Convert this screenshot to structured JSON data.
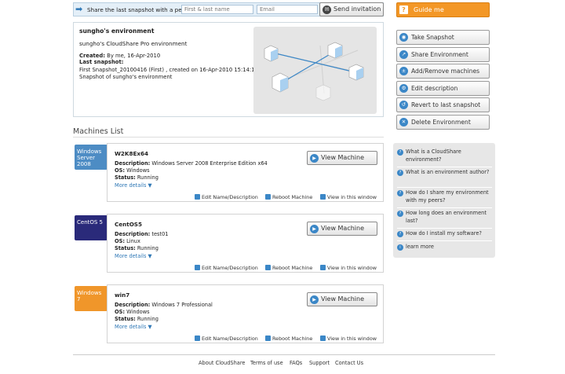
{
  "share": {
    "label": "Share the last snapshot with a peer:",
    "name_placeholder": "First & last name",
    "email_placeholder": "Email",
    "send_label": "Send invitation"
  },
  "guide": {
    "label": "Guide me"
  },
  "environment": {
    "title": "sungho's environment",
    "subtitle": "sungho's CloudShare Pro environment",
    "created_label": "Created:",
    "created_value": "By me, 16-Apr-2010",
    "last_snapshot_label": "Last snapshot:",
    "last_snapshot_value": "First Snapshot_20100416 (First) , created on 16-Apr-2010 15:14:14",
    "last_snapshot_desc": "Snapshot of sungho's environment"
  },
  "machines_list": {
    "title": "Machines List",
    "labels": {
      "description": "Description:",
      "os": "OS:",
      "status": "Status:"
    },
    "more_details": "More details",
    "view_label": "View Machine",
    "actions": {
      "edit": "Edit Name/Description",
      "reboot": "Reboot Machine",
      "view_window": "View in this window"
    },
    "machines": [
      {
        "logo": "Windows Server 2008",
        "logo_color": "#4d8cc4",
        "name": "W2K8Ex64",
        "description": "Windows Server 2008 Enterprise Edition x64",
        "os": "Windows",
        "status": "Running"
      },
      {
        "logo": "CentOS 5",
        "logo_color": "#2a2a7a",
        "name": "CentOS5",
        "description": "test01",
        "os": "Linux",
        "status": "Running"
      },
      {
        "logo": "Windows 7",
        "logo_color": "#f0962a",
        "name": "win7",
        "description": "Windows 7 Professional",
        "os": "Windows",
        "status": "Running"
      }
    ]
  },
  "right_actions": [
    {
      "label": "Take Snapshot",
      "icon": "camera-icon"
    },
    {
      "label": "Share Environment",
      "icon": "share-icon"
    },
    {
      "label": "Add/Remove machines",
      "icon": "add-remove-icon"
    },
    {
      "label": "Edit description",
      "icon": "gear-icon"
    },
    {
      "label": "Revert to last snapshot",
      "icon": "revert-icon"
    },
    {
      "label": "Delete Environment",
      "icon": "delete-icon"
    }
  ],
  "faq": [
    "What is a CloudShare environment?",
    "What is an environment author?",
    "How do I share my environment with my peers?",
    "How long does an environment last?",
    "How do I install my software?",
    "learn more"
  ],
  "footer": [
    "About CloudShare",
    "Terms of use",
    "FAQs",
    "Support",
    "Contact Us"
  ],
  "colors": {
    "accent": "#3b87c7",
    "guide": "#f39726"
  }
}
